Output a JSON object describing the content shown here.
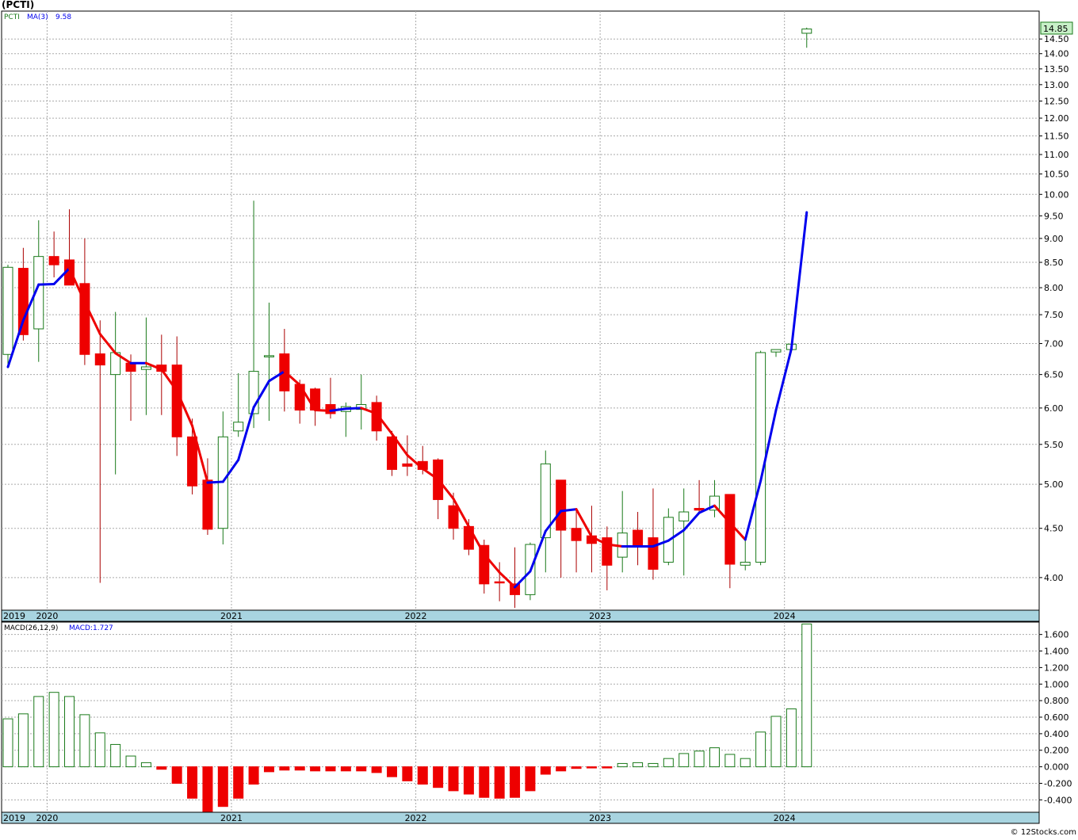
{
  "title": "(PCTI)",
  "watermark": "© 12Stocks.com",
  "price_panel": {
    "legend_ticker": "PCTI",
    "legend_ma": "MA(3)",
    "legend_ma_value": "9.58",
    "last_price_badge": "14.85"
  },
  "macd_panel": {
    "legend_name": "MACD(26,12,9)",
    "legend_value": "MACD:1.727"
  },
  "colors": {
    "up_candle": "#1a7a1a",
    "down_candle": "#ee0000",
    "ma_up": "#0000ee",
    "ma_down": "#ee0000",
    "axis_band": "#a8d4e0",
    "grid": "#aaaaaa",
    "badge_fill": "#c8f0c8"
  },
  "chart_data": [
    {
      "type": "candlestick",
      "title": "(PCTI)",
      "interval": "monthly",
      "y_scale": "log",
      "ylim": [
        3.7,
        15.5
      ],
      "y_ticks": [
        "4.00",
        "4.50",
        "5.00",
        "5.50",
        "6.00",
        "6.50",
        "7.00",
        "7.50",
        "8.00",
        "8.50",
        "9.00",
        "9.50",
        "10.00",
        "10.50",
        "11.00",
        "11.50",
        "12.00",
        "12.50",
        "13.00",
        "13.50",
        "14.00",
        "14.50"
      ],
      "x_year_labels": [
        "2019",
        "2020",
        "2021",
        "2022",
        "2023",
        "2024"
      ],
      "grid": true,
      "legend": "top-left",
      "candles": [
        {
          "date": "2019-10",
          "open": 6.82,
          "high": 8.45,
          "low": 6.6,
          "close": 8.4
        },
        {
          "date": "2019-11",
          "open": 8.38,
          "high": 8.8,
          "low": 7.05,
          "close": 7.15
        },
        {
          "date": "2019-12",
          "open": 7.25,
          "high": 9.4,
          "low": 6.7,
          "close": 8.62
        },
        {
          "date": "2020-01",
          "open": 8.62,
          "high": 9.15,
          "low": 8.2,
          "close": 8.45
        },
        {
          "date": "2020-02",
          "open": 8.55,
          "high": 9.65,
          "low": 8.15,
          "close": 8.05
        },
        {
          "date": "2020-03",
          "open": 8.08,
          "high": 9.0,
          "low": 6.65,
          "close": 6.82
        },
        {
          "date": "2020-04",
          "open": 6.83,
          "high": 7.4,
          "low": 3.95,
          "close": 6.65
        },
        {
          "date": "2020-05",
          "open": 6.5,
          "high": 7.55,
          "low": 5.12,
          "close": 6.85
        },
        {
          "date": "2020-06",
          "open": 6.68,
          "high": 6.82,
          "low": 5.82,
          "close": 6.55
        },
        {
          "date": "2020-07",
          "open": 6.58,
          "high": 7.45,
          "low": 5.9,
          "close": 6.62
        },
        {
          "date": "2020-08",
          "open": 6.65,
          "high": 7.15,
          "low": 5.9,
          "close": 6.55
        },
        {
          "date": "2020-09",
          "open": 6.65,
          "high": 7.12,
          "low": 5.35,
          "close": 5.6
        },
        {
          "date": "2020-10",
          "open": 5.6,
          "high": 5.85,
          "low": 4.88,
          "close": 4.98
        },
        {
          "date": "2020-11",
          "open": 5.05,
          "high": 5.32,
          "low": 4.43,
          "close": 4.49
        },
        {
          "date": "2020-12",
          "open": 4.5,
          "high": 5.95,
          "low": 4.33,
          "close": 5.6
        },
        {
          "date": "2021-01",
          "open": 5.68,
          "high": 6.52,
          "low": 5.6,
          "close": 5.8
        },
        {
          "date": "2021-02",
          "open": 5.92,
          "high": 9.85,
          "low": 5.72,
          "close": 6.55
        },
        {
          "date": "2021-03",
          "open": 6.78,
          "high": 7.72,
          "low": 5.82,
          "close": 6.8
        },
        {
          "date": "2021-04",
          "open": 6.83,
          "high": 7.25,
          "low": 5.95,
          "close": 6.25
        },
        {
          "date": "2021-05",
          "open": 6.35,
          "high": 6.42,
          "low": 5.78,
          "close": 5.97
        },
        {
          "date": "2021-06",
          "open": 6.28,
          "high": 6.3,
          "low": 5.75,
          "close": 5.97
        },
        {
          "date": "2021-07",
          "open": 6.05,
          "high": 6.45,
          "low": 5.85,
          "close": 5.92
        },
        {
          "date": "2021-08",
          "open": 5.95,
          "high": 6.08,
          "low": 5.6,
          "close": 6.02
        },
        {
          "date": "2021-09",
          "open": 5.98,
          "high": 6.5,
          "low": 5.7,
          "close": 6.05
        },
        {
          "date": "2021-10",
          "open": 6.08,
          "high": 6.18,
          "low": 5.55,
          "close": 5.68
        },
        {
          "date": "2021-11",
          "open": 5.6,
          "high": 5.68,
          "low": 5.1,
          "close": 5.18
        },
        {
          "date": "2021-12",
          "open": 5.25,
          "high": 5.62,
          "low": 5.1,
          "close": 5.22
        },
        {
          "date": "2022-01",
          "open": 5.28,
          "high": 5.48,
          "low": 5.12,
          "close": 5.18
        },
        {
          "date": "2022-02",
          "open": 5.3,
          "high": 5.32,
          "low": 4.6,
          "close": 4.82
        },
        {
          "date": "2022-03",
          "open": 4.75,
          "high": 4.9,
          "low": 4.38,
          "close": 4.5
        },
        {
          "date": "2022-04",
          "open": 4.52,
          "high": 4.6,
          "low": 4.22,
          "close": 4.28
        },
        {
          "date": "2022-05",
          "open": 4.32,
          "high": 4.38,
          "low": 3.85,
          "close": 3.94
        },
        {
          "date": "2022-06",
          "open": 3.96,
          "high": 4.15,
          "low": 3.78,
          "close": 3.95
        },
        {
          "date": "2022-07",
          "open": 3.94,
          "high": 4.3,
          "low": 3.72,
          "close": 3.84
        },
        {
          "date": "2022-08",
          "open": 3.84,
          "high": 4.35,
          "low": 3.79,
          "close": 4.33
        },
        {
          "date": "2022-09",
          "open": 4.4,
          "high": 5.42,
          "low": 4.05,
          "close": 5.25
        },
        {
          "date": "2022-10",
          "open": 5.05,
          "high": 5.05,
          "low": 4.0,
          "close": 4.48
        },
        {
          "date": "2022-11",
          "open": 4.5,
          "high": 4.72,
          "low": 4.05,
          "close": 4.37
        },
        {
          "date": "2022-12",
          "open": 4.42,
          "high": 4.75,
          "low": 4.05,
          "close": 4.34
        },
        {
          "date": "2023-01",
          "open": 4.4,
          "high": 4.52,
          "low": 3.88,
          "close": 4.12
        },
        {
          "date": "2023-02",
          "open": 4.2,
          "high": 4.92,
          "low": 4.05,
          "close": 4.45
        },
        {
          "date": "2023-03",
          "open": 4.48,
          "high": 4.68,
          "low": 4.12,
          "close": 4.32
        },
        {
          "date": "2023-04",
          "open": 4.4,
          "high": 4.95,
          "low": 3.98,
          "close": 4.08
        },
        {
          "date": "2023-05",
          "open": 4.15,
          "high": 4.72,
          "low": 4.12,
          "close": 4.62
        },
        {
          "date": "2023-06",
          "open": 4.58,
          "high": 4.95,
          "low": 4.02,
          "close": 4.68
        },
        {
          "date": "2023-07",
          "open": 4.72,
          "high": 5.05,
          "low": 4.68,
          "close": 4.7
        },
        {
          "date": "2023-08",
          "open": 4.7,
          "high": 5.05,
          "low": 4.62,
          "close": 4.86
        },
        {
          "date": "2023-09",
          "open": 4.88,
          "high": 4.88,
          "low": 3.9,
          "close": 4.13
        },
        {
          "date": "2023-10",
          "open": 4.12,
          "high": 4.4,
          "low": 4.07,
          "close": 4.15
        },
        {
          "date": "2023-11",
          "open": 4.15,
          "high": 6.88,
          "low": 4.12,
          "close": 6.85
        },
        {
          "date": "2023-12",
          "open": 6.86,
          "high": 6.9,
          "low": 6.78,
          "close": 6.9
        },
        {
          "date": "2024-01",
          "open": 6.9,
          "high": 6.99,
          "low": 6.88,
          "close": 6.99
        },
        {
          "date": "2024-02",
          "open": 14.7,
          "high": 14.9,
          "low": 14.2,
          "close": 14.85
        }
      ],
      "moving_average": {
        "name": "MA(3)",
        "values": [
          6.62,
          7.4,
          8.06,
          8.07,
          8.38,
          7.73,
          7.16,
          6.84,
          6.68,
          6.68,
          6.58,
          6.25,
          5.75,
          5.02,
          5.03,
          5.3,
          6.01,
          6.4,
          6.55,
          6.34,
          5.97,
          5.96,
          5.99,
          6.0,
          5.92,
          5.64,
          5.36,
          5.19,
          5.06,
          4.83,
          4.52,
          4.23,
          4.05,
          3.91,
          4.06,
          4.47,
          4.69,
          4.71,
          4.41,
          4.33,
          4.31,
          4.31,
          4.31,
          4.37,
          4.48,
          4.67,
          4.75,
          4.56,
          4.38,
          5.04,
          5.97,
          6.91,
          9.58
        ]
      }
    },
    {
      "type": "bar",
      "title": "MACD(26,12,9)",
      "ylim": [
        -0.55,
        1.75
      ],
      "y_ticks": [
        "-0.400",
        "-0.200",
        "0.000",
        "0.200",
        "0.400",
        "0.600",
        "0.800",
        "1.000",
        "1.200",
        "1.400",
        "1.600"
      ],
      "x_year_labels": [
        "2019",
        "2020",
        "2021",
        "2022",
        "2023",
        "2024"
      ],
      "grid": true,
      "values": [
        0.58,
        0.64,
        0.85,
        0.9,
        0.85,
        0.63,
        0.41,
        0.27,
        0.13,
        0.05,
        -0.03,
        -0.2,
        -0.38,
        -0.54,
        -0.48,
        -0.38,
        -0.21,
        -0.06,
        -0.04,
        -0.04,
        -0.05,
        -0.05,
        -0.05,
        -0.05,
        -0.07,
        -0.12,
        -0.17,
        -0.21,
        -0.25,
        -0.29,
        -0.33,
        -0.37,
        -0.38,
        -0.37,
        -0.29,
        -0.09,
        -0.05,
        -0.02,
        -0.01,
        -0.01,
        0.04,
        0.05,
        0.04,
        0.1,
        0.16,
        0.19,
        0.23,
        0.15,
        0.1,
        0.42,
        0.61,
        0.7,
        1.727
      ]
    }
  ]
}
